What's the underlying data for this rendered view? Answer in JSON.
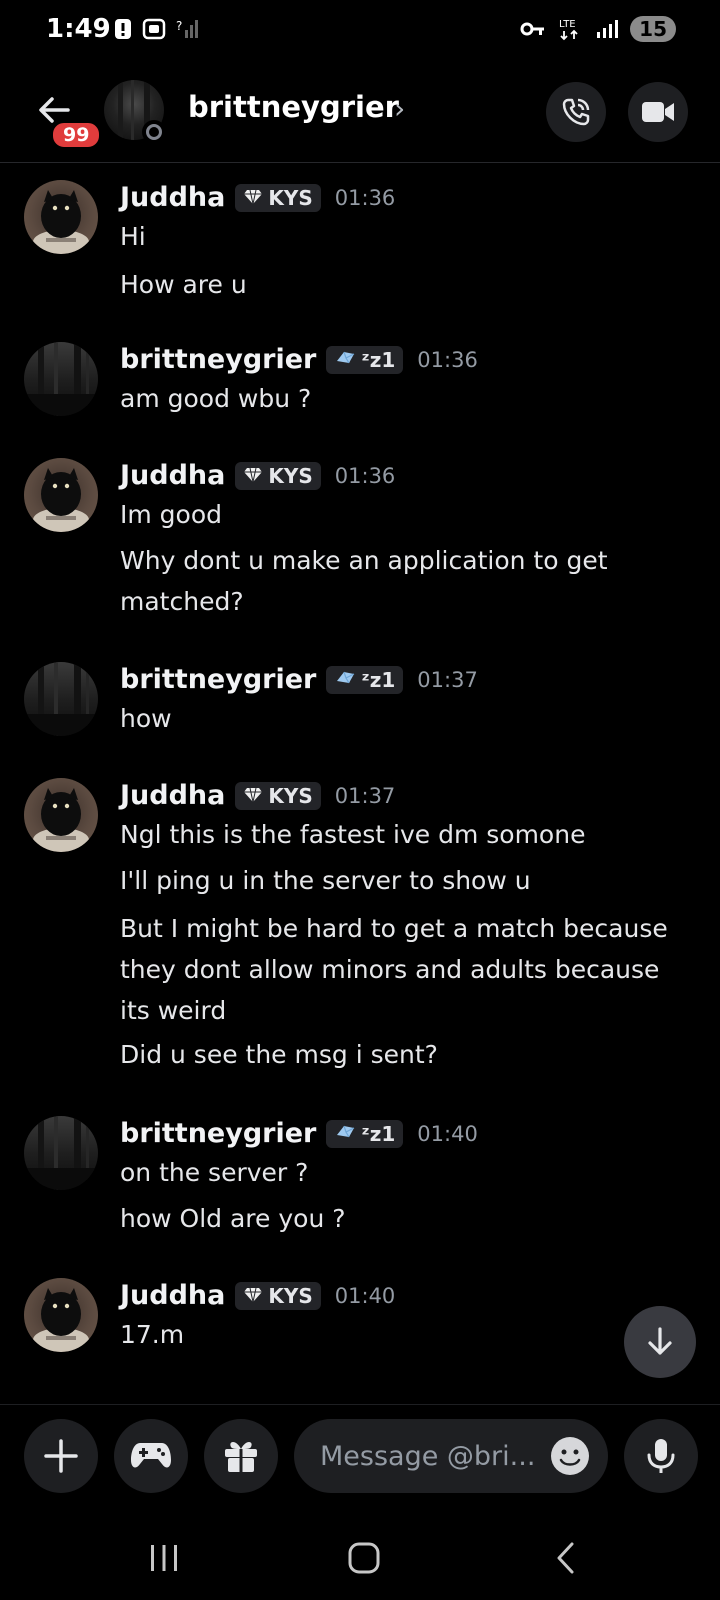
{
  "status_bar": {
    "time": "1:49",
    "battery": "15",
    "network": "LTE"
  },
  "header": {
    "unread_count": "99",
    "channel_name": "brittneygrier",
    "chevron": "›"
  },
  "messages": [
    {
      "author": "Juddha",
      "tag": "KYS",
      "tag_icon": "diamond-icon",
      "time": "01:36",
      "avatar": "cat",
      "lines": [
        "Hi",
        "How are u"
      ]
    },
    {
      "author": "brittneygrier",
      "tag": "ᶻz1",
      "tag_icon": "crystal-icon",
      "time": "01:36",
      "avatar": "forest",
      "lines": [
        "am good wbu ?"
      ]
    },
    {
      "author": "Juddha",
      "tag": "KYS",
      "tag_icon": "diamond-icon",
      "time": "01:36",
      "avatar": "cat",
      "lines": [
        "Im good",
        "Why dont u make an application to get matched?"
      ]
    },
    {
      "author": "brittneygrier",
      "tag": "ᶻz1",
      "tag_icon": "crystal-icon",
      "time": "01:37",
      "avatar": "forest",
      "lines": [
        "how"
      ]
    },
    {
      "author": "Juddha",
      "tag": "KYS",
      "tag_icon": "diamond-icon",
      "time": "01:37",
      "avatar": "cat",
      "lines": [
        "Ngl this is the fastest ive dm somone",
        "I'll ping u in the server to show u",
        "But I might be hard to get a match because they dont allow minors and adults because its weird",
        "Did u see the msg i sent?"
      ]
    },
    {
      "author": "brittneygrier",
      "tag": "ᶻz1",
      "tag_icon": "crystal-icon",
      "time": "01:40",
      "avatar": "forest",
      "lines": [
        "on the server ?",
        "how Old are you ?"
      ]
    },
    {
      "author": "Juddha",
      "tag": "KYS",
      "tag_icon": "diamond-icon",
      "time": "01:40",
      "avatar": "cat",
      "lines": [
        "17.m"
      ]
    }
  ],
  "composer": {
    "placeholder": "Message @bri..."
  },
  "colors": {
    "background": "#000000",
    "surface": "#1e1f22",
    "badge_red": "#e03c3c",
    "muted_text": "#949ba4"
  }
}
